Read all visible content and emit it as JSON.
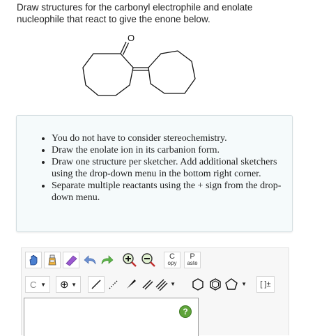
{
  "question": {
    "text": "Draw structures for the carbonyl electrophile and enolate nucleophile that react to give the enone below."
  },
  "molecule": {
    "atom_label": "O"
  },
  "notes": {
    "items": [
      "You do not have to consider stereochemistry.",
      "Draw the enolate ion in its carbanion form.",
      "Draw one structure per sketcher. Add additional sketchers using the drop-down menu in the bottom right corner.",
      "Separate multiple reactants using the + sign from the drop-down menu."
    ]
  },
  "toolbar": {
    "copy_label_top": "C",
    "copy_label_bottom": "opy",
    "paste_label_top": "P",
    "paste_label_bottom": "aste",
    "element_label": "C",
    "bracket_label": "[ ]±",
    "charge_symbol": "⊕"
  },
  "canvas": {
    "help_label": "?"
  },
  "colors": {
    "panel_bg": "#f5fafb",
    "help_green": "#5fa43a",
    "eraser_purple": "#9b59d0",
    "arrow_blue": "#6a8fd0",
    "arrow_green": "#5db34a"
  }
}
